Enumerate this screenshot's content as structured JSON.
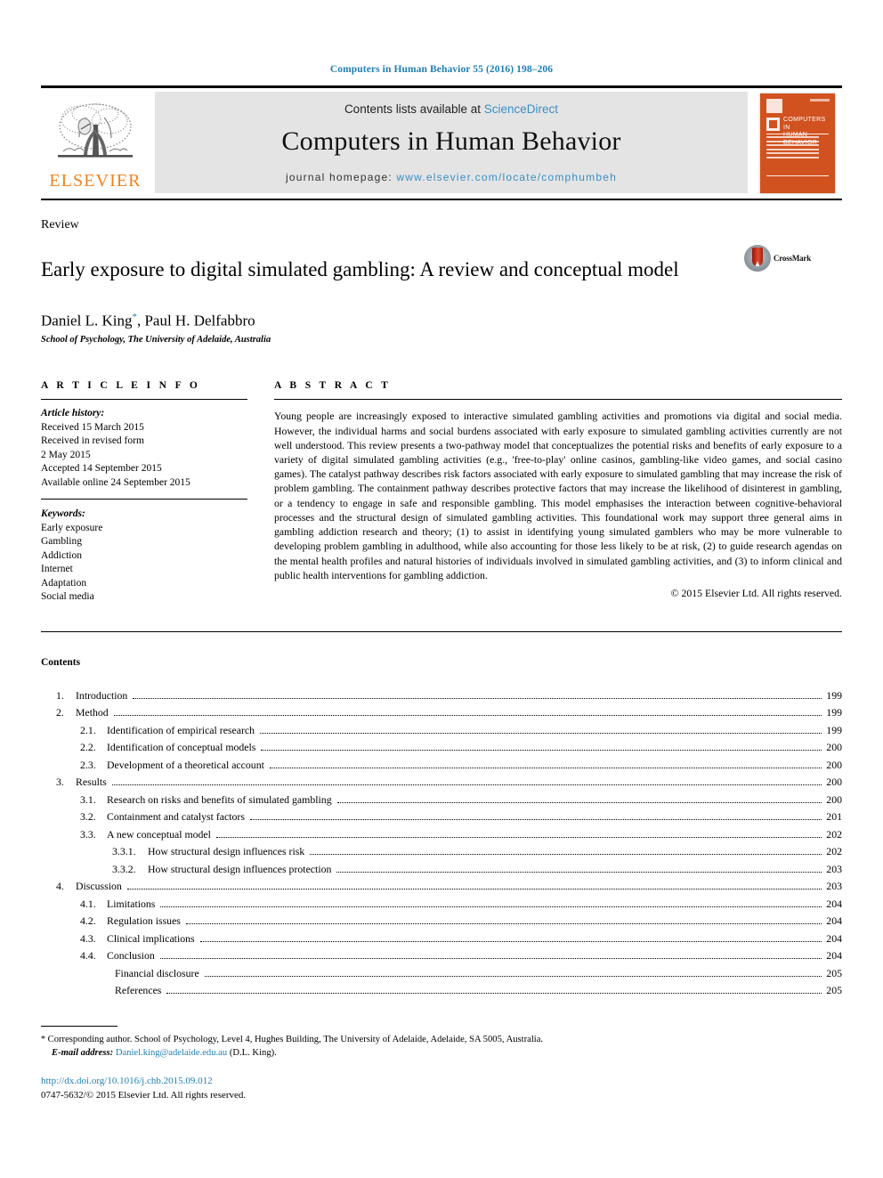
{
  "running_head": "Computers in Human Behavior 55 (2016) 198–206",
  "masthead": {
    "publisher_name": "ELSEVIER",
    "publisher_logo_icon": "elsevier-tree-icon",
    "contents_prefix": "Contents lists available at ",
    "sciencedirect": "ScienceDirect",
    "journal_title": "Computers in Human Behavior",
    "homepage_prefix": "journal homepage: ",
    "homepage_url": "www.elsevier.com/locate/comphumbeh",
    "cover": {
      "title_line1": "COMPUTERS IN",
      "title_line2": "HUMAN BEHAVIOR",
      "accent_color": "#d1521f"
    },
    "link_color": "#3b8fc4"
  },
  "article": {
    "doctype": "Review",
    "title": "Early exposure to digital simulated gambling: A review and conceptual model",
    "crossmark_label": "CrossMark",
    "authors": "Daniel L. King",
    "author_star": "*",
    "authors_rest": ", Paul H. Delfabbro",
    "affiliation": "School of Psychology, The University of Adelaide, Australia"
  },
  "article_info": {
    "heading": "A R T I C L E   I N F O",
    "history_label": "Article history:",
    "history": [
      "Received 15 March 2015",
      "Received in revised form",
      "2 May 2015",
      "Accepted 14 September 2015",
      "Available online 24 September 2015"
    ],
    "keywords_label": "Keywords:",
    "keywords": [
      "Early exposure",
      "Gambling",
      "Addiction",
      "Internet",
      "Adaptation",
      "Social media"
    ]
  },
  "abstract": {
    "heading": "A B S T R A C T",
    "text": "Young people are increasingly exposed to interactive simulated gambling activities and promotions via digital and social media. However, the individual harms and social burdens associated with early exposure to simulated gambling activities currently are not well understood. This review presents a two-pathway model that conceptualizes the potential risks and benefits of early exposure to a variety of digital simulated gambling activities (e.g., 'free-to-play' online casinos, gambling-like video games, and social casino games). The catalyst pathway describes risk factors associated with early exposure to simulated gambling that may increase the risk of problem gambling. The containment pathway describes protective factors that may increase the likelihood of disinterest in gambling, or a tendency to engage in safe and responsible gambling. This model emphasises the interaction between cognitive-behavioral processes and the structural design of simulated gambling activities. This foundational work may support three general aims in gambling addiction research and theory; (1) to assist in identifying young simulated gamblers who may be more vulnerable to developing problem gambling in adulthood, while also accounting for those less likely to be at risk, (2) to guide research agendas on the mental health profiles and natural histories of individuals involved in simulated gambling activities, and (3) to inform clinical and public health interventions for gambling addiction.",
    "copyright": "© 2015 Elsevier Ltd. All rights reserved."
  },
  "contents": {
    "heading": "Contents",
    "entries": [
      {
        "level": 1,
        "num": "1.",
        "label": "Introduction",
        "page": "199"
      },
      {
        "level": 1,
        "num": "2.",
        "label": "Method",
        "page": "199"
      },
      {
        "level": 2,
        "num": "2.1.",
        "label": "Identification of empirical research",
        "page": "199"
      },
      {
        "level": 2,
        "num": "2.2.",
        "label": "Identification of conceptual models",
        "page": "200"
      },
      {
        "level": 2,
        "num": "2.3.",
        "label": "Development of a theoretical account",
        "page": "200"
      },
      {
        "level": 1,
        "num": "3.",
        "label": "Results",
        "page": "200"
      },
      {
        "level": 2,
        "num": "3.1.",
        "label": "Research on risks and benefits of simulated  gambling",
        "page": "200"
      },
      {
        "level": 2,
        "num": "3.2.",
        "label": "Containment and catalyst factors",
        "page": "201"
      },
      {
        "level": 2,
        "num": "3.3.",
        "label": "A new conceptual model",
        "page": "202"
      },
      {
        "level": 3,
        "num": "3.3.1.",
        "label": "How structural design influences risk",
        "page": "202"
      },
      {
        "level": 3,
        "num": "3.3.2.",
        "label": "How structural design influences protection",
        "page": "203"
      },
      {
        "level": 1,
        "num": "4.",
        "label": "Discussion",
        "page": "203"
      },
      {
        "level": 2,
        "num": "4.1.",
        "label": "Limitations",
        "page": "204"
      },
      {
        "level": 2,
        "num": "4.2.",
        "label": "Regulation issues",
        "page": "204"
      },
      {
        "level": 2,
        "num": "4.3.",
        "label": "Clinical implications",
        "page": "204"
      },
      {
        "level": 2,
        "num": "4.4.",
        "label": "Conclusion",
        "page": "204"
      },
      {
        "level": 0,
        "num": "",
        "label": "Financial disclosure",
        "page": "205"
      },
      {
        "level": 0,
        "num": "",
        "label": "References",
        "page": "205"
      }
    ]
  },
  "footer": {
    "corresponding_star": "*",
    "corresponding": "Corresponding author. School of Psychology, Level 4, Hughes Building, The University of Adelaide, Adelaide, SA 5005, Australia.",
    "email_label": "E-mail address:",
    "email": "Daniel.king@adelaide.edu.au",
    "email_owner": "(D.L. King).",
    "doi": "http://dx.doi.org/10.1016/j.chb.2015.09.012",
    "issn_line": "0747-5632/© 2015 Elsevier Ltd. All rights reserved.",
    "link_color": "#1f7fb5"
  }
}
